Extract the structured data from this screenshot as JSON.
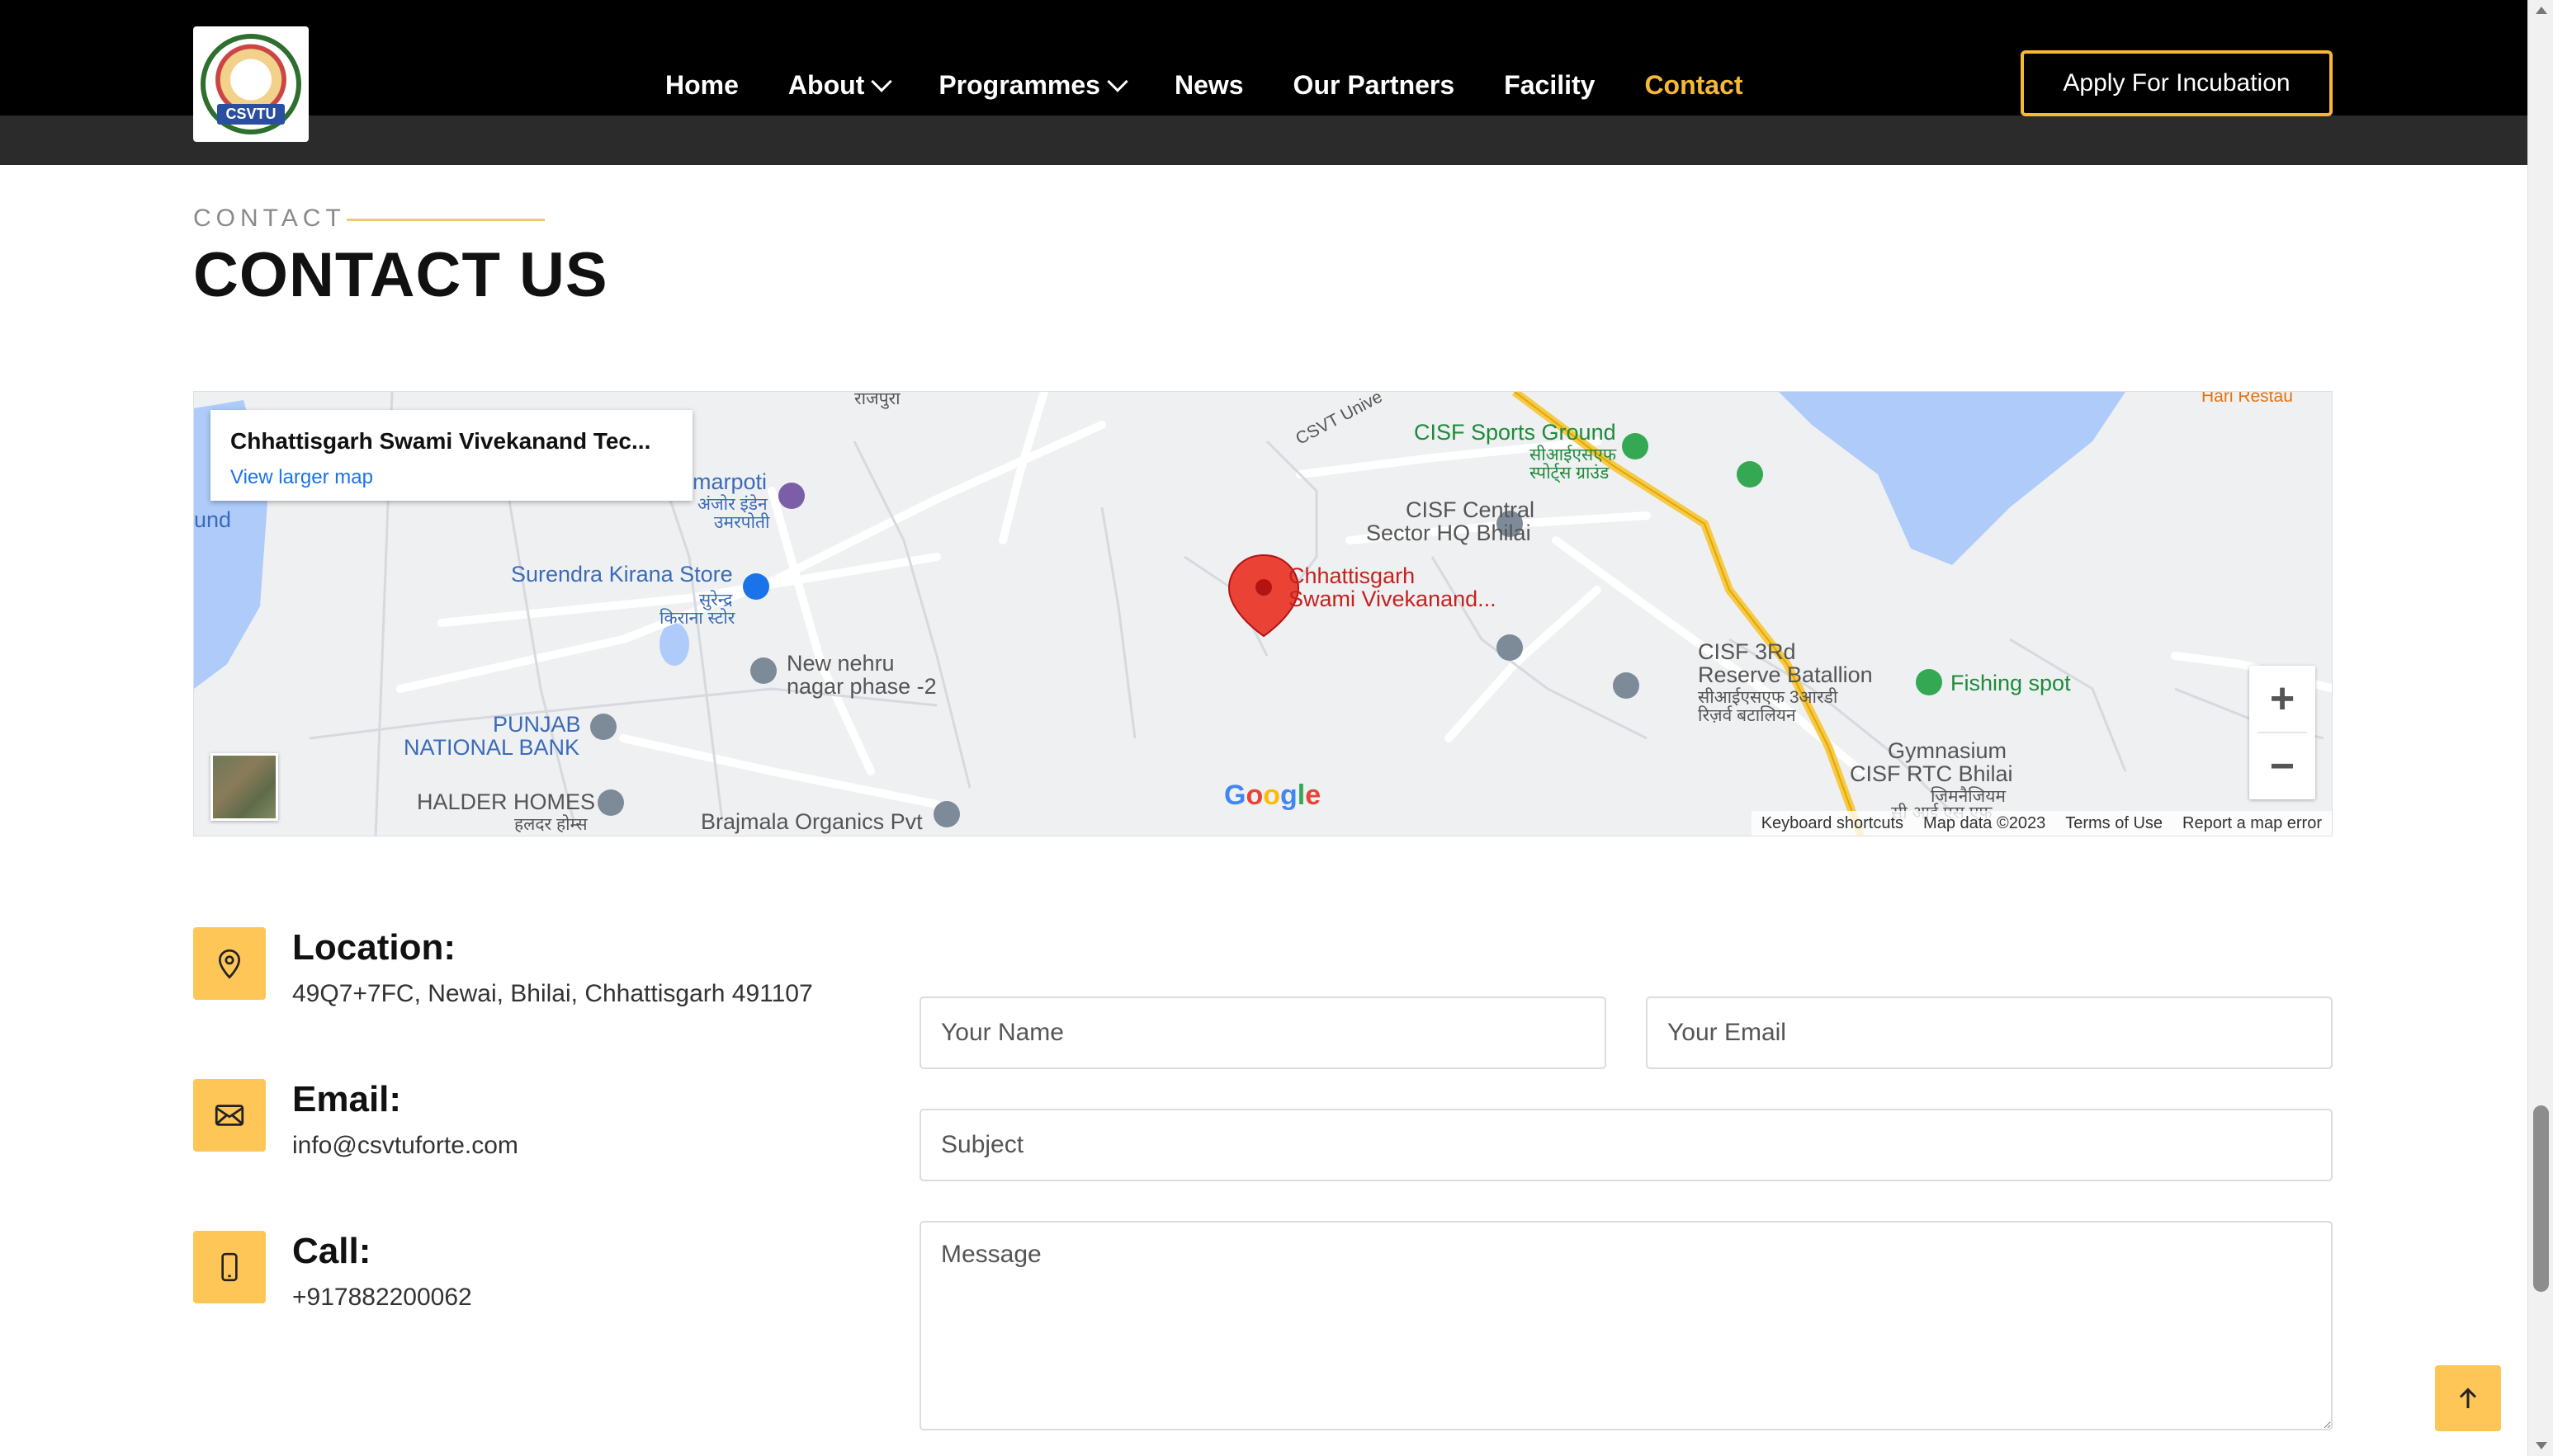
{
  "header": {
    "logo_text": "CSVTU",
    "nav": [
      {
        "label": "Home",
        "active": false,
        "dropdown": false
      },
      {
        "label": "About",
        "active": false,
        "dropdown": true
      },
      {
        "label": "Programmes",
        "active": false,
        "dropdown": true
      },
      {
        "label": "News",
        "active": false,
        "dropdown": false
      },
      {
        "label": "Our Partners",
        "active": false,
        "dropdown": false
      },
      {
        "label": "Facility",
        "active": false,
        "dropdown": false
      },
      {
        "label": "Contact",
        "active": true,
        "dropdown": false
      }
    ],
    "apply_label": "Apply For Incubation"
  },
  "section": {
    "label": "CONTACT",
    "title": "CONTACT US"
  },
  "map": {
    "card_title": "Chhattisgarh Swami Vivekanand Tec...",
    "card_link": "View larger map",
    "marker_label_1": "Chhattisgarh",
    "marker_label_2": "Swami Vivekanand...",
    "labels": {
      "cisf_sports": "CISF Sports Ground",
      "cisf_sports_hi": "सीआईएसएफ",
      "cisf_sports_hi2": "स्पोर्ट्स ग्राउंड",
      "cisf_central_1": "CISF Central",
      "cisf_central_2": "Sector HQ Bhilai",
      "surendra": "Surendra Kirana Store",
      "surendra_hi_1": "सुरेन्द्र",
      "surendra_hi_2": "किराना स्टोर",
      "marpoti": "marpoti",
      "marpoti_hi_1": "अंजोर इंडेन",
      "marpoti_hi_2": "उमरपोती",
      "new_nehru_1": "New nehru",
      "new_nehru_2": "nagar phase -2",
      "punjab_1": "PUNJAB",
      "punjab_2": "NATIONAL BANK",
      "halder": "HALDER HOMES",
      "halder_hi": "हलदर होम्स",
      "brajmala": "Brajmala Organics Pvt",
      "cisf_3rd_1": "CISF 3Rd",
      "cisf_3rd_2": "Reserve Batallion",
      "cisf_3rd_hi_1": "सीआईएसएफ 3आरडी",
      "cisf_3rd_hi_2": "रिज़र्व बटालियन",
      "fishing": "Fishing spot",
      "gym_1": "Gymnasium",
      "gym_2": "CISF RTC Bhilai",
      "gym_hi": "जिमनैजियम",
      "gym_hi_2": "सी आई एस एफ",
      "und": "und",
      "csvt_road": "CSVT Unive",
      "top_road": "राजपुरा",
      "top_right": "Hari Restau"
    },
    "zoom_in": "+",
    "zoom_out": "−",
    "google": "Google",
    "footer": [
      "Keyboard shortcuts",
      "Map data ©2023",
      "Terms of Use",
      "Report a map error"
    ]
  },
  "contact": {
    "location_title": "Location:",
    "location_value": "49Q7+7FC, Newai, Bhilai, Chhattisgarh 491107",
    "email_title": "Email:",
    "email_value": "info@csvtuforte.com",
    "call_title": "Call:",
    "call_value": "+917882200062"
  },
  "form": {
    "name_placeholder": "Your Name",
    "email_placeholder": "Your Email",
    "subject_placeholder": "Subject",
    "message_placeholder": "Message"
  },
  "colors": {
    "accent": "#fdc657",
    "active_nav": "#f5b935",
    "header_bg": "#000000"
  },
  "icons": [
    "location-pin-icon",
    "envelope-icon",
    "phone-icon",
    "arrow-up-icon",
    "chevron-down-icon"
  ]
}
